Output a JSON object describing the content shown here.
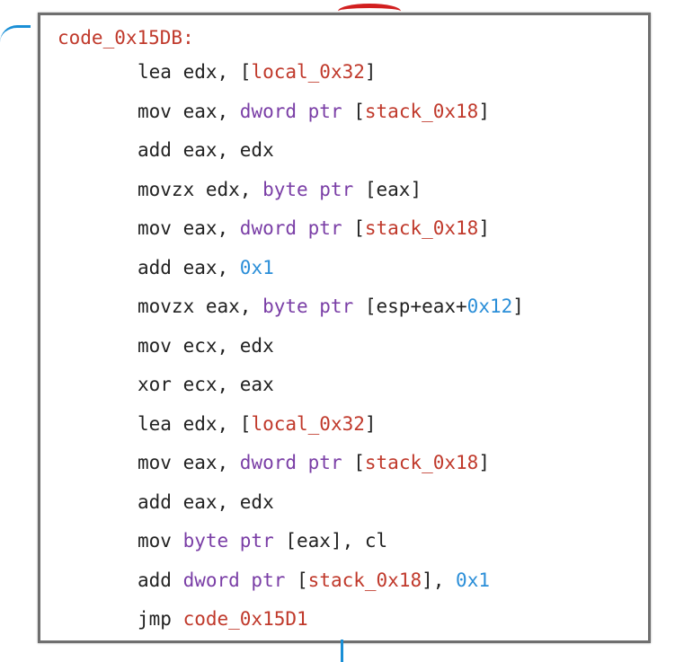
{
  "colors": {
    "label": "#c0392b",
    "keyword": "#7a3ea6",
    "reference": "#c0392b",
    "number": "#2a8ed8",
    "text": "#222222",
    "border": "#6f6f6f",
    "edge_blue": "#1a8fd6",
    "edge_red": "#d21f1f"
  },
  "block": {
    "label": "code_0x15DB:",
    "lines": [
      [
        {
          "t": "lea edx, ["
        },
        {
          "t": "local_0x32",
          "c": "ref"
        },
        {
          "t": "]"
        }
      ],
      [
        {
          "t": "mov eax, "
        },
        {
          "t": "dword ptr",
          "c": "kw"
        },
        {
          "t": " ["
        },
        {
          "t": "stack_0x18",
          "c": "ref"
        },
        {
          "t": "]"
        }
      ],
      [
        {
          "t": "add eax, edx"
        }
      ],
      [
        {
          "t": "movzx edx, "
        },
        {
          "t": "byte ptr",
          "c": "kw"
        },
        {
          "t": " [eax]"
        }
      ],
      [
        {
          "t": "mov eax, "
        },
        {
          "t": "dword ptr",
          "c": "kw"
        },
        {
          "t": " ["
        },
        {
          "t": "stack_0x18",
          "c": "ref"
        },
        {
          "t": "]"
        }
      ],
      [
        {
          "t": "add eax, "
        },
        {
          "t": "0x1",
          "c": "num"
        }
      ],
      [
        {
          "t": "movzx eax, "
        },
        {
          "t": "byte ptr",
          "c": "kw"
        },
        {
          "t": " [esp+eax+"
        },
        {
          "t": "0x12",
          "c": "num"
        },
        {
          "t": "]"
        }
      ],
      [
        {
          "t": "mov ecx, edx"
        }
      ],
      [
        {
          "t": "xor ecx, eax"
        }
      ],
      [
        {
          "t": "lea edx, ["
        },
        {
          "t": "local_0x32",
          "c": "ref"
        },
        {
          "t": "]"
        }
      ],
      [
        {
          "t": "mov eax, "
        },
        {
          "t": "dword ptr",
          "c": "kw"
        },
        {
          "t": " ["
        },
        {
          "t": "stack_0x18",
          "c": "ref"
        },
        {
          "t": "]"
        }
      ],
      [
        {
          "t": "add eax, edx"
        }
      ],
      [
        {
          "t": "mov "
        },
        {
          "t": "byte ptr",
          "c": "kw"
        },
        {
          "t": " [eax], cl"
        }
      ],
      [
        {
          "t": "add "
        },
        {
          "t": "dword ptr",
          "c": "kw"
        },
        {
          "t": " ["
        },
        {
          "t": "stack_0x18",
          "c": "ref"
        },
        {
          "t": "], "
        },
        {
          "t": "0x1",
          "c": "num"
        }
      ],
      [
        {
          "t": "jmp "
        },
        {
          "t": "code_0x15D1",
          "c": "ref"
        }
      ]
    ]
  }
}
